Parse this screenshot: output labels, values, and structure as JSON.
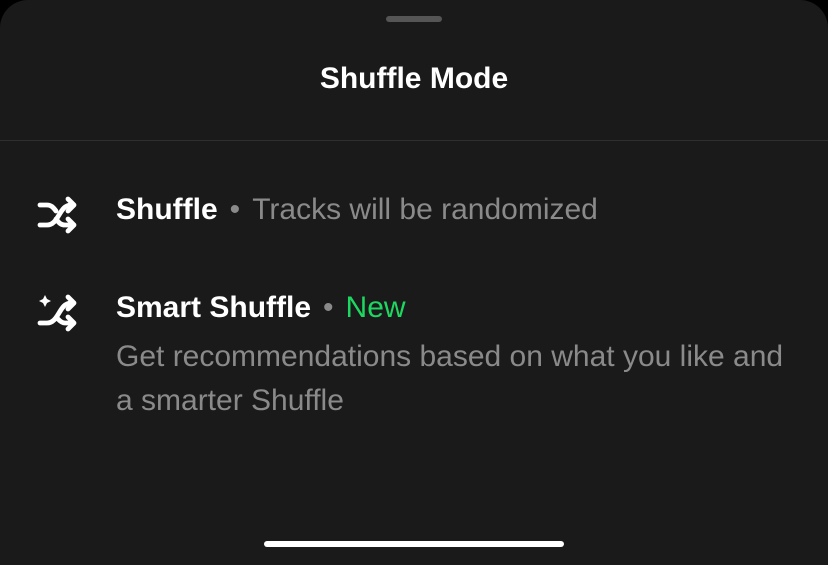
{
  "header": {
    "title": "Shuffle Mode"
  },
  "options": [
    {
      "icon": "shuffle-icon",
      "title": "Shuffle",
      "inline_sub": "Tracks will be randomized",
      "badge": null,
      "description": null
    },
    {
      "icon": "smart-shuffle-icon",
      "title": "Smart Shuffle",
      "inline_sub": null,
      "badge": "New",
      "description": "Get recommendations based on what you like and a smarter Shuffle"
    }
  ],
  "colors": {
    "background": "#1a1a1a",
    "text_primary": "#ffffff",
    "text_secondary": "#8a8a8a",
    "accent_badge": "#1ed760"
  }
}
